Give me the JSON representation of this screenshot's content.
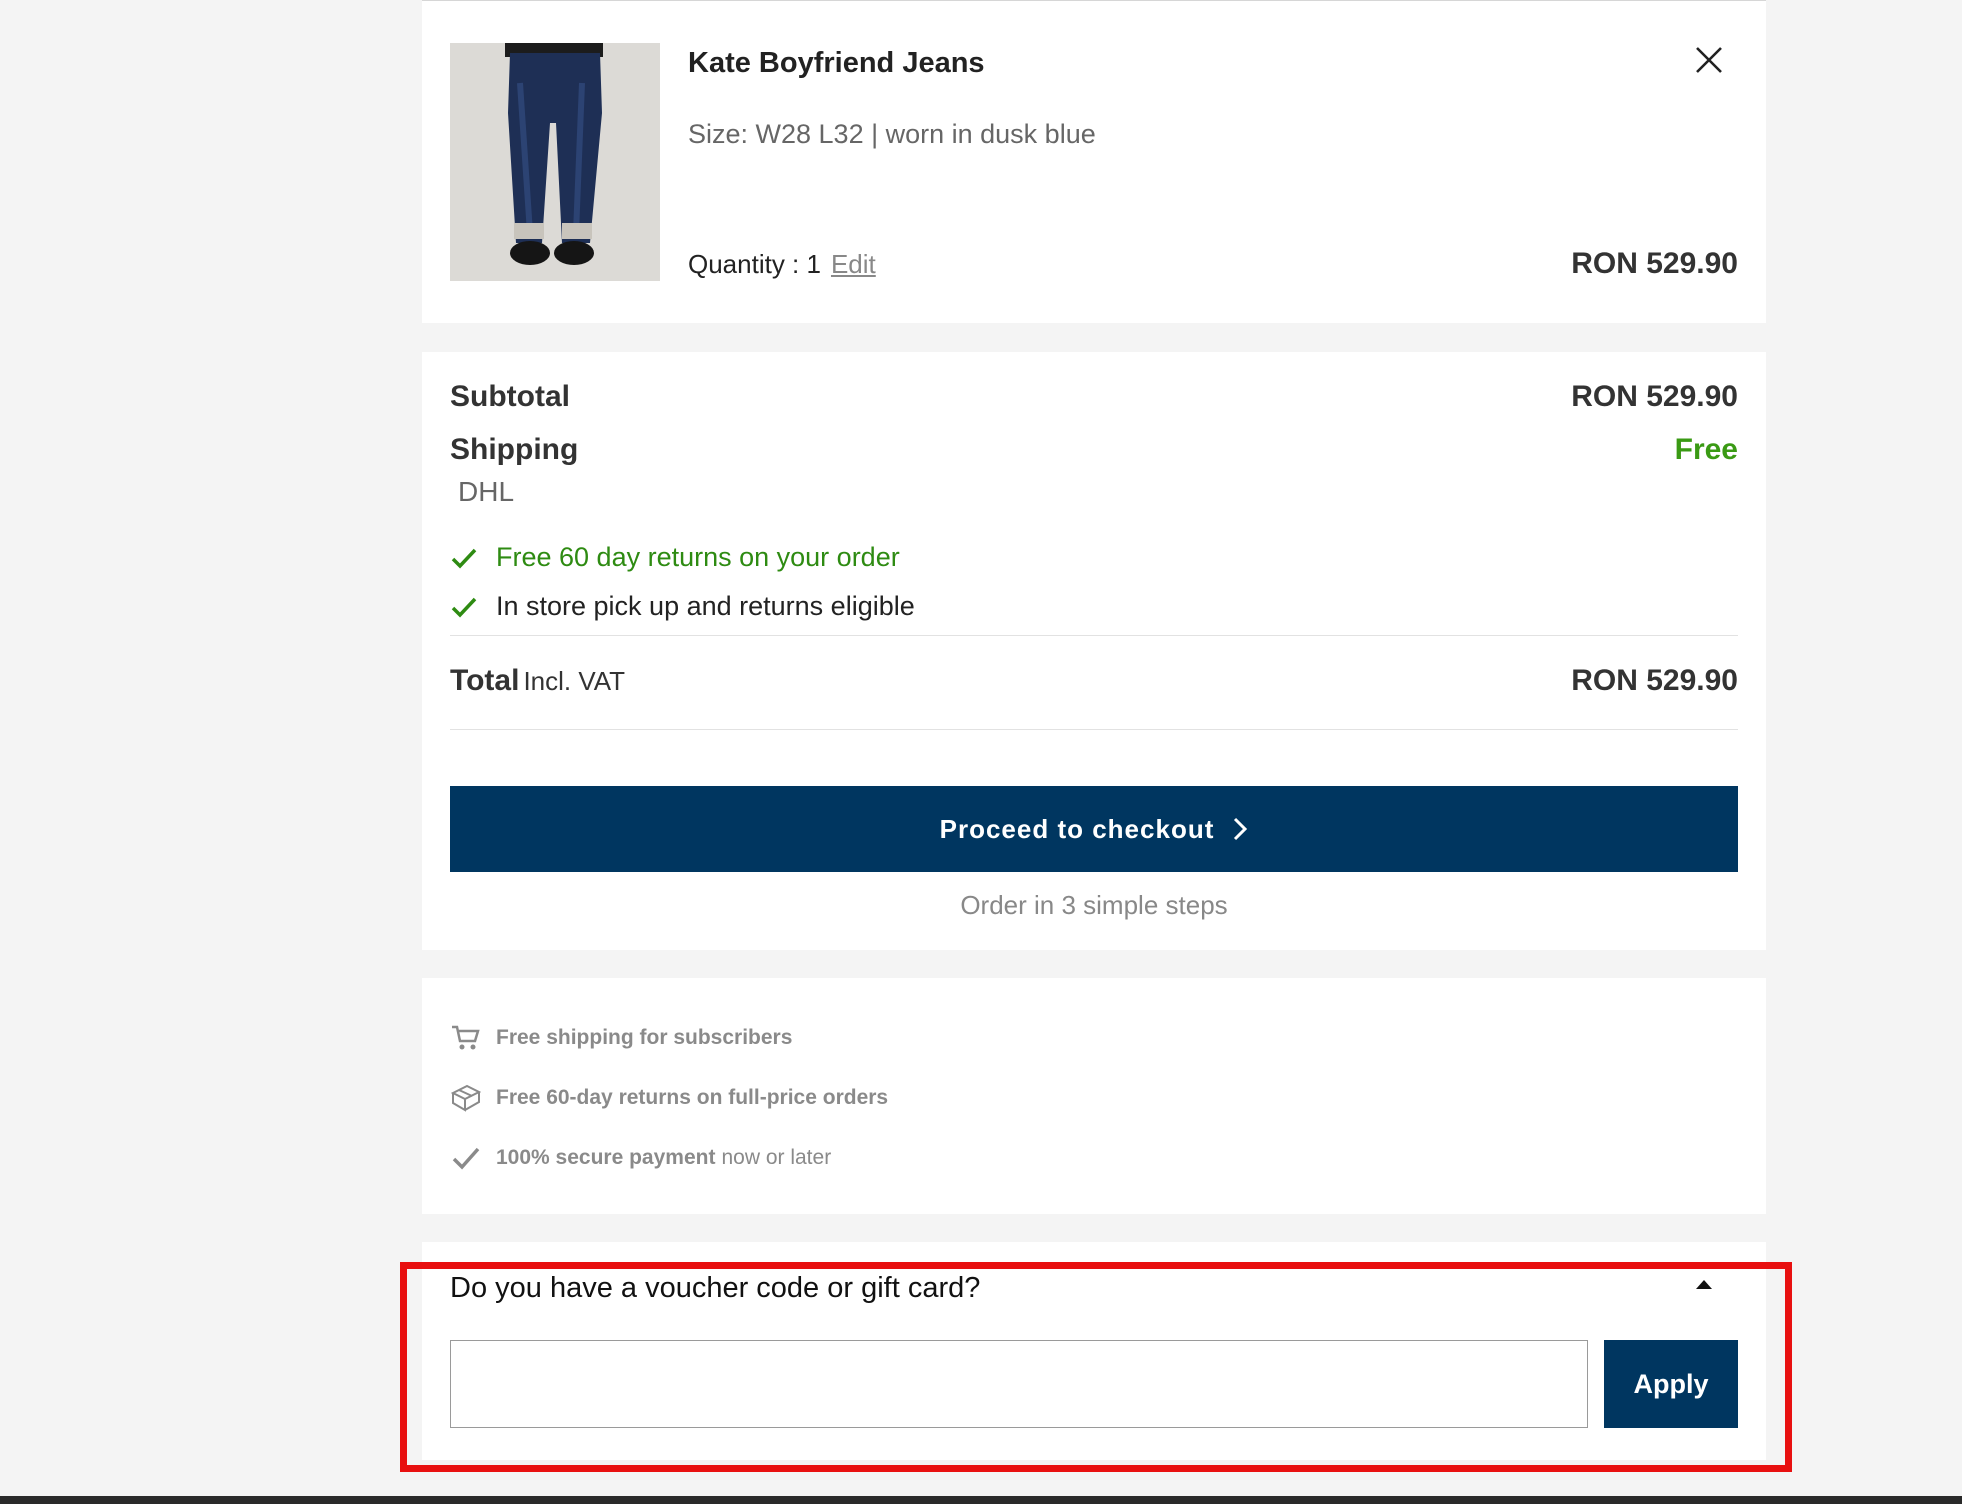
{
  "cart_item": {
    "name": "Kate Boyfriend Jeans",
    "variant": "Size: W28 L32 | worn in dusk blue",
    "quantity_label": "Quantity : 1",
    "edit_label": "Edit",
    "price": "RON 529.90",
    "remove_icon": "close-icon"
  },
  "summary": {
    "subtotal_label": "Subtotal",
    "subtotal_value": "RON 529.90",
    "shipping_label": "Shipping",
    "shipping_value": "Free",
    "carrier": "DHL",
    "benefits": [
      "Free 60 day returns on your order",
      "In store pick up and returns eligible"
    ],
    "total_label": "Total",
    "total_sub": "Incl. VAT",
    "total_value": "RON 529.90",
    "checkout_label": "Proceed to checkout",
    "steps_note": "Order in 3 simple steps"
  },
  "usps": [
    {
      "icon": "cart-icon",
      "bold": "Free shipping for subscribers",
      "light": ""
    },
    {
      "icon": "box-icon",
      "bold": "Free 60-day returns on full-price orders",
      "light": ""
    },
    {
      "icon": "check-icon",
      "bold": "100% secure payment",
      "light": "now or later"
    }
  ],
  "voucher": {
    "question": "Do you have a voucher code or gift card?",
    "input_value": "",
    "apply_label": "Apply"
  },
  "colors": {
    "primary": "#003660",
    "free_green": "#3a9a14",
    "highlight": "#e81010",
    "background": "#f4f4f4"
  }
}
